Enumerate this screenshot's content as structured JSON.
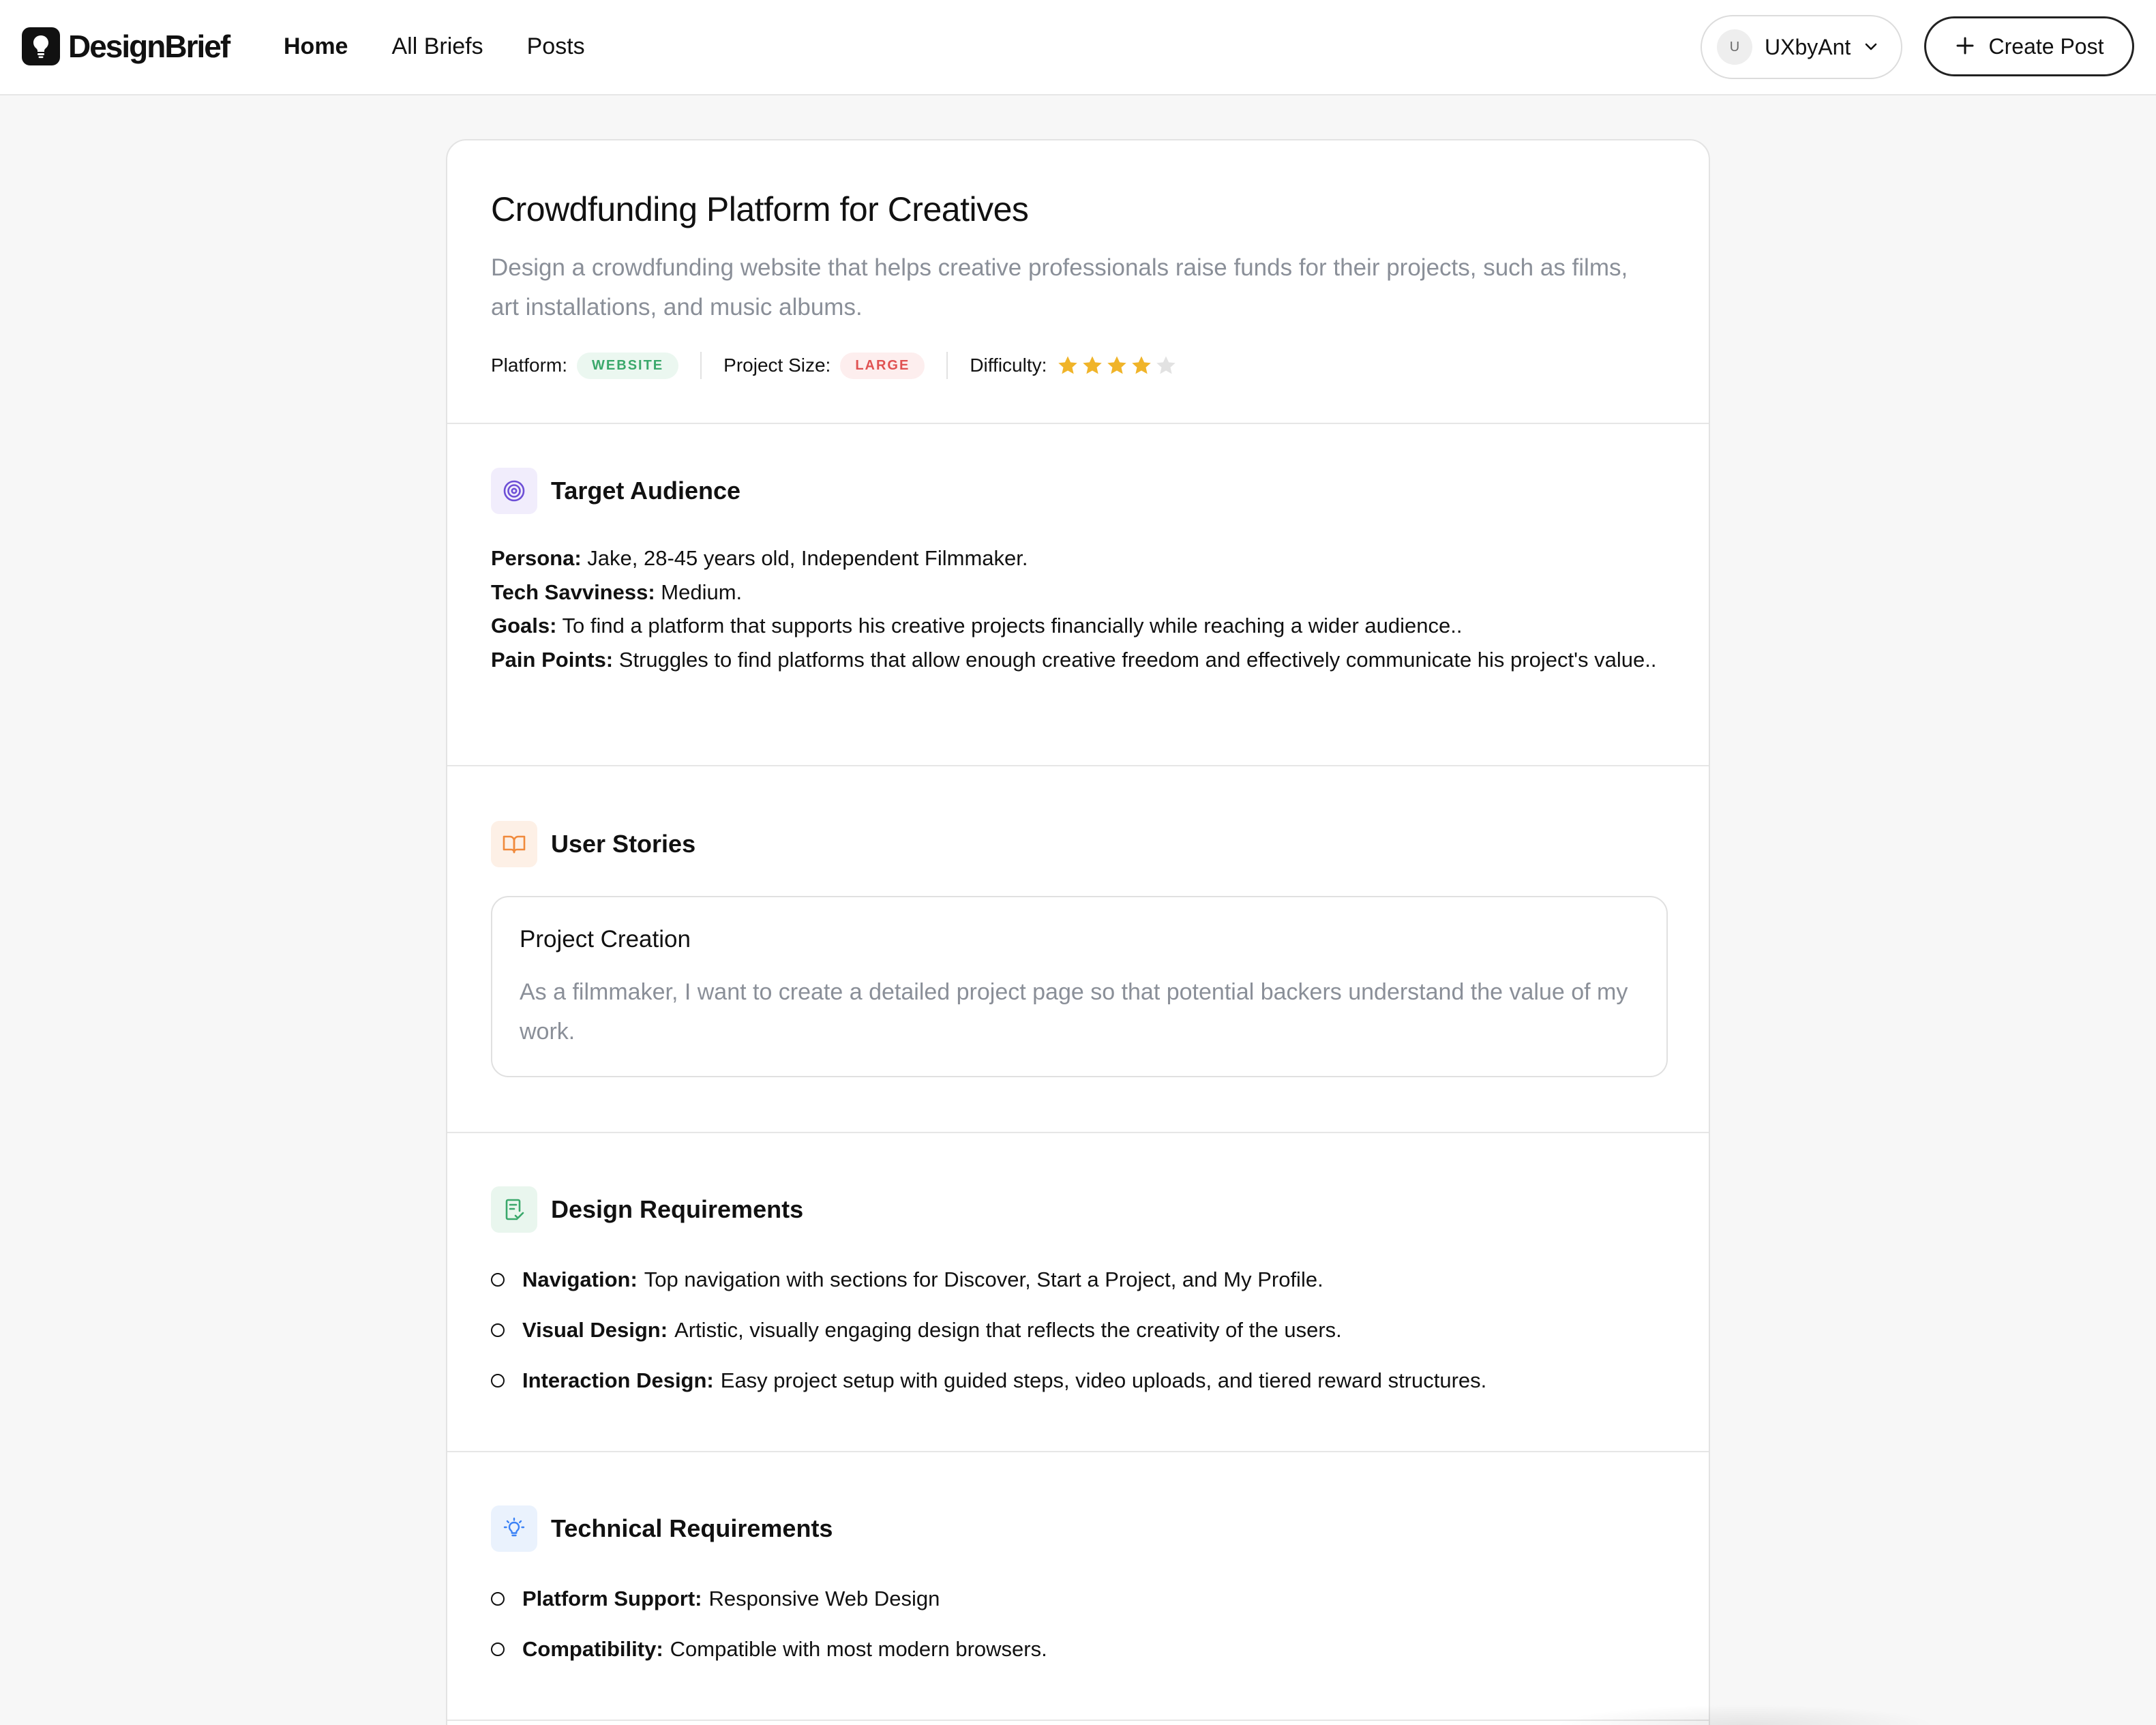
{
  "header": {
    "brand": "DesignBrief",
    "nav": [
      "Home",
      "All Briefs",
      "Posts"
    ],
    "user": {
      "initial": "U",
      "name": "UXbyAnt"
    },
    "create_label": "Create Post"
  },
  "brief": {
    "title": "Crowdfunding Platform for Creatives",
    "description": "Design a crowdfunding website that helps creative professionals raise funds for their projects, such as films, art installations, and music albums.",
    "meta": {
      "platform_label": "Platform:",
      "platform_value": "WEBSITE",
      "size_label": "Project Size:",
      "size_value": "LARGE",
      "difficulty_label": "Difficulty:",
      "difficulty_stars": 4,
      "difficulty_max": 5
    }
  },
  "sections": {
    "audience": {
      "title": "Target Audience",
      "persona_label": "Persona:",
      "persona_value": "Jake, 28-45 years old, Independent Filmmaker.",
      "tech_label": "Tech Savviness:",
      "tech_value": "Medium.",
      "goals_label": "Goals:",
      "goals_value": "To find a platform that supports his creative projects financially while reaching a wider audience..",
      "pain_label": "Pain Points:",
      "pain_value": "Struggles to find platforms that allow enough creative freedom and effectively communicate his project's value.."
    },
    "stories": {
      "title": "User Stories",
      "items": [
        {
          "title": "Project Creation",
          "text": "As a filmmaker, I want to create a detailed project page so that potential backers understand the value of my work."
        }
      ]
    },
    "design": {
      "title": "Design Requirements",
      "items": [
        {
          "label": "Navigation:",
          "value": "Top navigation with sections for Discover, Start a Project, and My Profile."
        },
        {
          "label": "Visual Design:",
          "value": "Artistic, visually engaging design that reflects the creativity of the users."
        },
        {
          "label": "Interaction Design:",
          "value": "Easy project setup with guided steps, video uploads, and tiered reward structures."
        }
      ]
    },
    "technical": {
      "title": "Technical Requirements",
      "items": [
        {
          "label": "Platform Support:",
          "value": "Responsive Web Design"
        },
        {
          "label": "Compatibility:",
          "value": "Compatible with most modern browsers."
        }
      ]
    }
  },
  "colors": {
    "star_filled": "#f0b429",
    "star_empty": "#e2e2e2",
    "audience_icon": "#6d4fd6",
    "stories_icon": "#f08a3c",
    "design_icon": "#3aa86b",
    "technical_icon": "#3b82f6"
  },
  "icons": {
    "logo": "lightbulb-icon",
    "user_menu": "chevron-down-icon",
    "create": "plus-icon",
    "audience": "target-icon",
    "stories": "book-open-icon",
    "design": "clipboard-check-icon",
    "technical": "lightbulb-icon"
  }
}
